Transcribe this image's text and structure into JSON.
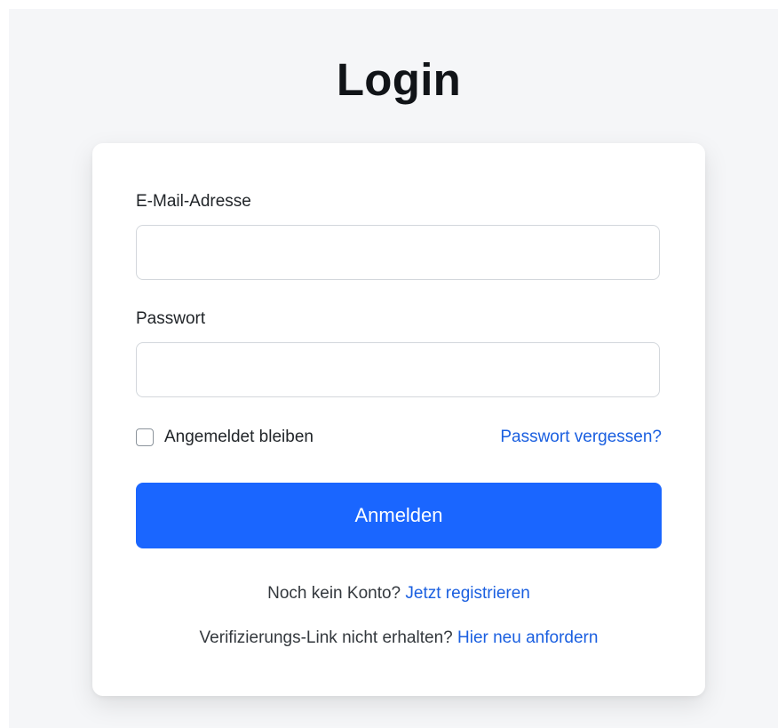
{
  "page": {
    "title": "Login"
  },
  "form": {
    "email_label": "E-Mail-Adresse",
    "email_value": "",
    "password_label": "Passwort",
    "password_value": "",
    "remember_label": "Angemeldet bleiben",
    "remember_checked": false,
    "forgot_link": "Passwort vergessen?",
    "submit_label": "Anmelden"
  },
  "footer": {
    "register_prompt": "Noch kein Konto?",
    "register_link": "Jetzt registrieren",
    "verify_prompt": "Verifizierungs-Link nicht erhalten?",
    "verify_link": "Hier neu anfordern"
  },
  "colors": {
    "background": "#f5f6f8",
    "card": "#ffffff",
    "primary": "#1a66ff",
    "link": "#1a5fe0",
    "text": "#212529"
  }
}
